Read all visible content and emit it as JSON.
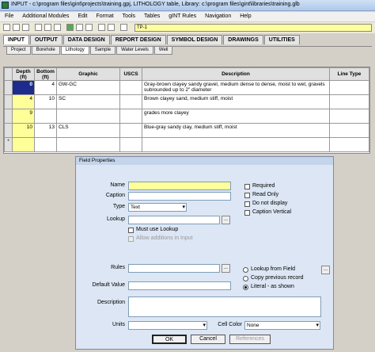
{
  "window": {
    "title": "INPUT - c:\\program files\\gint\\projects\\training.gpj, LITHOLOGY table, Library: c:\\program files\\gint\\libraries\\training.glb"
  },
  "menu": [
    "File",
    "Additional Modules",
    "Edit",
    "Format",
    "Tools",
    "Tables",
    "gINT Rules",
    "Navigation",
    "Help"
  ],
  "toolbar": {
    "point_id": "TP-1"
  },
  "main_tabs": [
    "INPUT",
    "OUTPUT",
    "DATA DESIGN",
    "REPORT DESIGN",
    "SYMBOL DESIGN",
    "DRAWINGS",
    "UTILITIES"
  ],
  "sub_tabs": [
    "Project",
    "Borehole",
    "Lithology",
    "Sample",
    "Water Levels",
    "Well"
  ],
  "grid": {
    "columns": [
      "Depth (ft)",
      "Bottom (ft)",
      "Graphic",
      "USCS",
      "Description",
      "Line Type"
    ],
    "rows": [
      {
        "depth": "0",
        "bottom": "4",
        "graphic": "GW-GC",
        "uscs": "",
        "description": "Gray-brown clayey sandy gravel, medium dense to dense, moist to wet, gravels subrounded up to 2\" diameter"
      },
      {
        "depth": "4",
        "bottom": "10",
        "graphic": "SC",
        "uscs": "",
        "description": "Brown clayey sand, medium stiff, moist"
      },
      {
        "depth": "9",
        "bottom": "",
        "graphic": "",
        "uscs": "",
        "description": "grades more clayey"
      },
      {
        "depth": "10",
        "bottom": "13",
        "graphic": "CLS",
        "uscs": "",
        "description": "Blue-gray sandy clay, medium stiff, moist"
      }
    ],
    "new_row_marker": "*"
  },
  "dialog": {
    "title": "Field Properties",
    "labels": {
      "name": "Name",
      "caption": "Caption",
      "type": "Type",
      "lookup": "Lookup",
      "rules": "Rules",
      "default_value": "Default Value",
      "description": "Description",
      "units": "Units",
      "cell_color": "Cell Color"
    },
    "type_value": "Text",
    "cell_color_value": "None",
    "checkboxes": {
      "required": "Required",
      "read_only": "Read Only",
      "do_not_display": "Do not display",
      "caption_vertical": "Caption Vertical",
      "must_use_lookup": "Must use Lookup",
      "allow_additions": "Allow additions in Input"
    },
    "radios": {
      "lookup_from_field": "Lookup from Field",
      "copy_previous": "Copy previous record",
      "literal": "Literal - as shown"
    },
    "buttons": {
      "ok": "OK",
      "cancel": "Cancel",
      "references": "References",
      "ellipsis": "..."
    }
  }
}
